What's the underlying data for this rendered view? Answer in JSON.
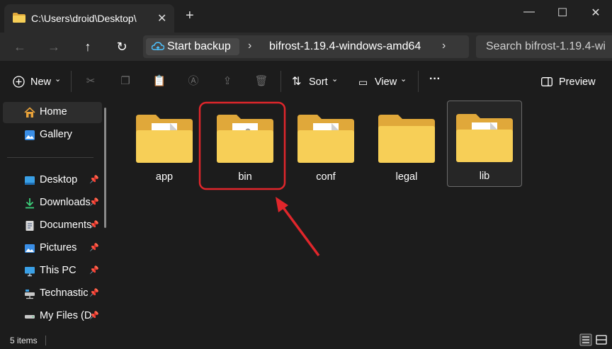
{
  "window": {
    "tab_title": "C:\\Users\\droid\\Desktop\\",
    "tab_close": "✕",
    "new_tab": "+",
    "minimize": "—",
    "maximize": "☐",
    "close": "✕"
  },
  "nav": {
    "back": "←",
    "forward": "→",
    "up": "↑",
    "refresh": "↻",
    "backup_label": "Start backup",
    "separator": "›",
    "current_folder": "bifrost-1.19.4-windows-amd64",
    "search_placeholder": "Search bifrost-1.19.4-wi"
  },
  "toolbar": {
    "new_label": "New",
    "sort_label": "Sort",
    "view_label": "View",
    "more_label": "···",
    "preview_label": "Preview",
    "chevron": "⌄",
    "icons": [
      "cut-icon",
      "copy-icon",
      "paste-icon",
      "rename-icon",
      "share-icon",
      "delete-icon"
    ]
  },
  "sidebar": {
    "items": [
      {
        "label": "Home",
        "icon": "home-icon"
      },
      {
        "label": "Gallery",
        "icon": "gallery-icon"
      },
      {
        "label": "Desktop",
        "icon": "desktop-icon",
        "pinned": true
      },
      {
        "label": "Downloads",
        "icon": "download-icon",
        "pinned": true
      },
      {
        "label": "Documents",
        "icon": "documents-icon",
        "pinned": true
      },
      {
        "label": "Pictures",
        "icon": "pictures-icon",
        "pinned": true
      },
      {
        "label": "This PC",
        "icon": "this-pc-icon",
        "pinned": true
      },
      {
        "label": "Technastic",
        "icon": "network-drive-icon",
        "pinned": true
      },
      {
        "label": "My Files (D",
        "icon": "drive-icon",
        "pinned": true
      }
    ],
    "pin_glyph": "📌"
  },
  "files": [
    {
      "name": "app",
      "icon": "folder-with-file-icon"
    },
    {
      "name": "bin",
      "icon": "folder-with-gear-icon"
    },
    {
      "name": "conf",
      "icon": "folder-with-file-icon"
    },
    {
      "name": "legal",
      "icon": "folder-icon"
    },
    {
      "name": "lib",
      "icon": "folder-with-file-icon"
    }
  ],
  "status": {
    "item_count": "5 items"
  },
  "colors": {
    "folder_front": "#f7cf57",
    "folder_back": "#e0a83a",
    "highlight": "#e0262b",
    "accent": "#4cc2ff"
  }
}
